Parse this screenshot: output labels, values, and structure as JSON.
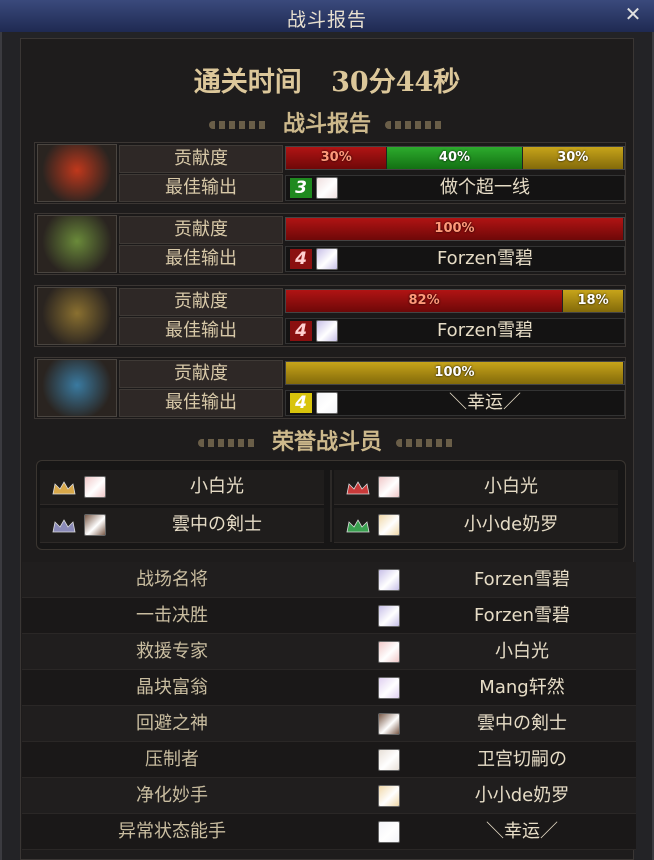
{
  "window": {
    "title": "战斗报告",
    "close_label": "✕"
  },
  "clear_time": {
    "label": "通关时间",
    "value": "30分44秒"
  },
  "sections": {
    "report": "战斗报告",
    "honor": "荣誉战斗员"
  },
  "row_labels": {
    "contribution": "贡献度",
    "best_output": "最佳输出"
  },
  "dungeons": [
    {
      "emblem_color": "#c0381c",
      "contribution": [
        {
          "label": "30%",
          "value": 30,
          "color": "red"
        },
        {
          "label": "40%",
          "value": 40,
          "color": "green"
        },
        {
          "label": "30%",
          "value": 30,
          "color": "gold"
        }
      ],
      "best_rank": "3",
      "rank_color": "green",
      "avatar": "#f0e0e0",
      "player": "做个超一线"
    },
    {
      "emblem_color": "#6a8a3a",
      "contribution": [
        {
          "label": "100%",
          "value": 100,
          "color": "red"
        }
      ],
      "best_rank": "4",
      "rank_color": "red",
      "avatar": "#c8c0e8",
      "player": "Forzen雪碧"
    },
    {
      "emblem_color": "#8a7030",
      "contribution": [
        {
          "label": "82%",
          "value": 82,
          "color": "red"
        },
        {
          "label": "18%",
          "value": 18,
          "color": "gold"
        }
      ],
      "best_rank": "4",
      "rank_color": "red",
      "avatar": "#c8c0e8",
      "player": "Forzen雪碧"
    },
    {
      "emblem_color": "#3a7aa0",
      "contribution": [
        {
          "label": "100%",
          "value": 100,
          "color": "gold"
        }
      ],
      "best_rank": "4",
      "rank_color": "yellow",
      "avatar": "#f4f4f8",
      "player": "＼幸运／"
    }
  ],
  "honor_members": [
    {
      "name": "小白光",
      "avatar": "#f0c8c8",
      "crown": "#d8a84a"
    },
    {
      "name": "小白光",
      "avatar": "#f0c8c8",
      "crown": "#c83a3a"
    },
    {
      "name": "雲中の剣士",
      "avatar": "#7a5a48",
      "crown": "#8a8ab8"
    },
    {
      "name": "小小de奶罗",
      "avatar": "#f0d8a8",
      "crown": "#3aa050"
    }
  ],
  "awards": [
    {
      "title": "战场名将",
      "player": "Forzen雪碧",
      "avatar": "#c8c0e8"
    },
    {
      "title": "一击决胜",
      "player": "Forzen雪碧",
      "avatar": "#c8c0e8"
    },
    {
      "title": "救援专家",
      "player": "小白光",
      "avatar": "#f0c8c8"
    },
    {
      "title": "晶块富翁",
      "player": "Mang轩然",
      "avatar": "#e0d0f0"
    },
    {
      "title": "回避之神",
      "player": "雲中の剣士",
      "avatar": "#7a5a48"
    },
    {
      "title": "压制者",
      "player": "卫宫切嗣の",
      "avatar": "#e8e0d8"
    },
    {
      "title": "净化妙手",
      "player": "小小de奶罗",
      "avatar": "#f0d8a8"
    },
    {
      "title": "异常状态能手",
      "player": "＼幸运／",
      "avatar": "#f4f4f8"
    }
  ]
}
